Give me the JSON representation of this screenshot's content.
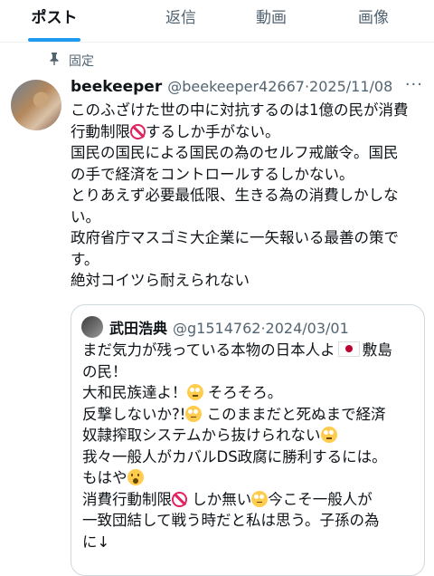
{
  "tabs": [
    {
      "label": "ポスト",
      "active": true
    },
    {
      "label": "返信",
      "active": false
    },
    {
      "label": "動画",
      "active": false
    },
    {
      "label": "画像",
      "active": false
    }
  ],
  "pinned": {
    "label": "固定",
    "icon": "pin-icon"
  },
  "post": {
    "name": "beekeeper",
    "handle": "@beekeeper42667",
    "separator": "·",
    "date": "2025/11/08",
    "more": "···",
    "lines": {
      "l1": "このふざけた世の中に対抗するのは1億の民が消費",
      "l2a": "行動制限",
      "l2b": "するしか手がない。",
      "l3": "国民の国民による国民の為のセルフ戒厳令。国民",
      "l4": "の手で経済をコントロールするしかない。",
      "l5": "とりあえず必要最低限、生きる為の消費しかしな",
      "l6": "い。",
      "l7": "政府省庁マスゴミ大企業に一矢報いる最善の策で",
      "l8": "す。",
      "l9": "絶対コイツら耐えられない"
    }
  },
  "quote": {
    "name": "武田浩典",
    "handle": "@g1514762",
    "separator": "·",
    "date": "2024/03/01",
    "lines": {
      "l1a": "まだ気力が残っている本物の日本人よ",
      "l1b": "敷島",
      "l2": "の民！",
      "l3a": "大和民族達よ！",
      "l3b": "そろそろ。",
      "l4a": "反撃しないか?!",
      "l4b": "このままだと死ぬまで経済",
      "l5": "奴隷搾取システムから抜けられない",
      "l6": "我々一般人がカバルDS政腐に勝利するには。",
      "l7": "もはや",
      "l8a": "消費行動制限",
      "l8b": "しか無い",
      "l8c": "今こそ一般人が",
      "l9": "一致団結して戦う時だと私は思う。子孫の為",
      "l10": "に↓"
    }
  }
}
